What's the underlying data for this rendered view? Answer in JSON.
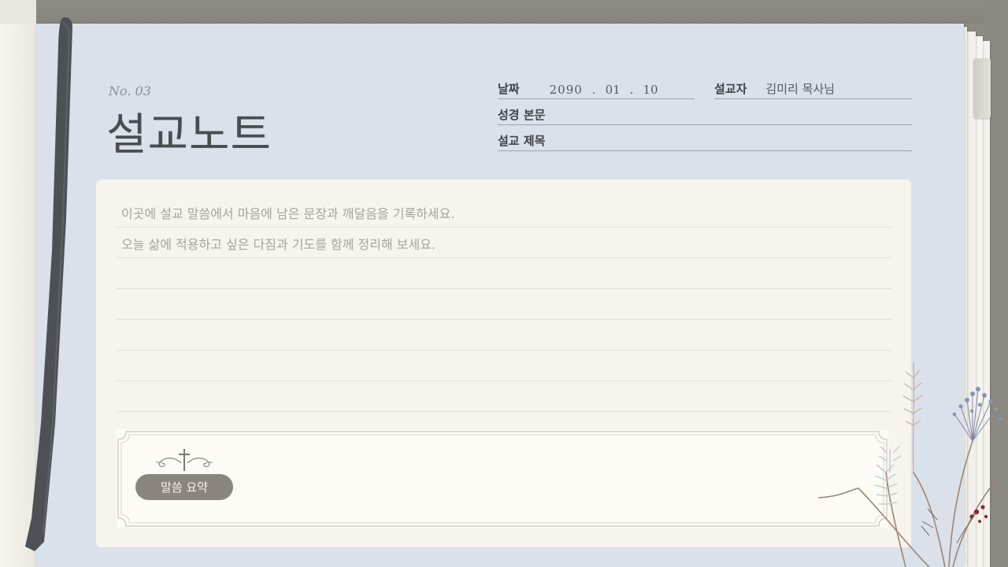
{
  "header": {
    "number": "No. 03",
    "title": "설교노트"
  },
  "meta": {
    "date_label": "날짜",
    "date_year": "2090",
    "date_month": "01",
    "date_day": "10",
    "date_separator": ".",
    "preacher_label": "설교자",
    "preacher_value": "김미리 목사님",
    "bible_label": "성경 본문",
    "bible_value": "",
    "sermon_title_label": "설교 제목",
    "sermon_title_value": ""
  },
  "notes": {
    "lines": [
      "이곳에 설교 말씀에서 마음에 남은 문장과 깨달음을 기록하세요.",
      "오늘 삶에 적용하고 싶은 다짐과 기도를 함께 정리해 보세요.",
      "",
      "",
      "",
      "",
      ""
    ]
  },
  "summary": {
    "badge_label": "말씀 요약"
  },
  "colors": {
    "page_blue": "#dbe1ea",
    "card_cream": "#f6f4ec",
    "badge_gray": "#8a857e",
    "ribbon": "#4d5054"
  }
}
